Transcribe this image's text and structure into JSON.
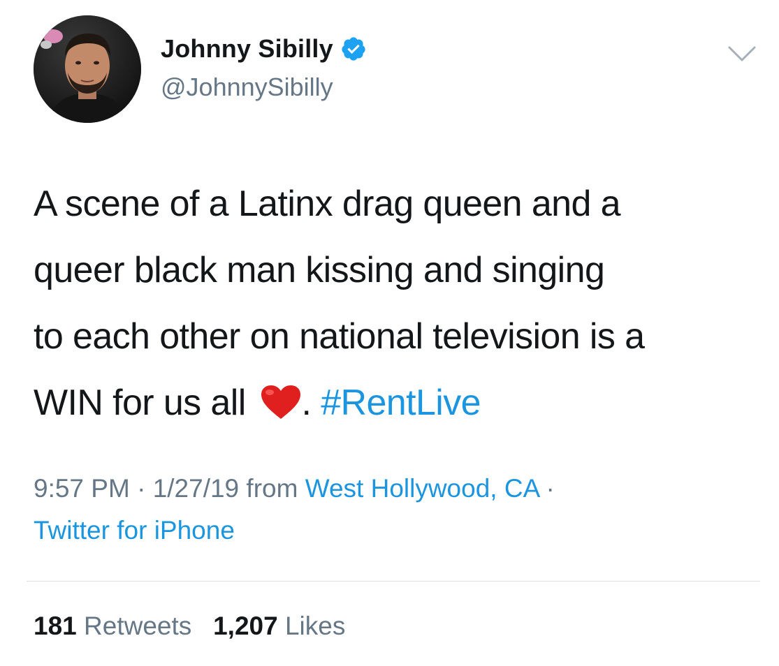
{
  "user": {
    "display_name": "Johnny Sibilly",
    "handle": "@JohnnySibilly",
    "verified_icon": "verified-badge-icon"
  },
  "tweet": {
    "lines": [
      "A scene of a Latinx drag queen and a",
      "queer black man kissing and singing",
      "to each other on national television is a"
    ],
    "last_line_prefix": "WIN for us all ",
    "emoji": "heart-emoji",
    "after_emoji": ". ",
    "hashtag": "#RentLive"
  },
  "meta": {
    "time": "9:57 PM",
    "separator1": " · ",
    "date": "1/27/19",
    "from_word": " from ",
    "location": "West Hollywood, CA",
    "separator2": " ·",
    "source": "Twitter for iPhone"
  },
  "stats": {
    "retweets_count": "181",
    "retweets_label": "Retweets",
    "likes_count": "1,207",
    "likes_label": "Likes"
  },
  "colors": {
    "link": "#1b95e0",
    "secondary_text": "#657786",
    "primary_text": "#14171a",
    "verified": "#1da1f2"
  }
}
